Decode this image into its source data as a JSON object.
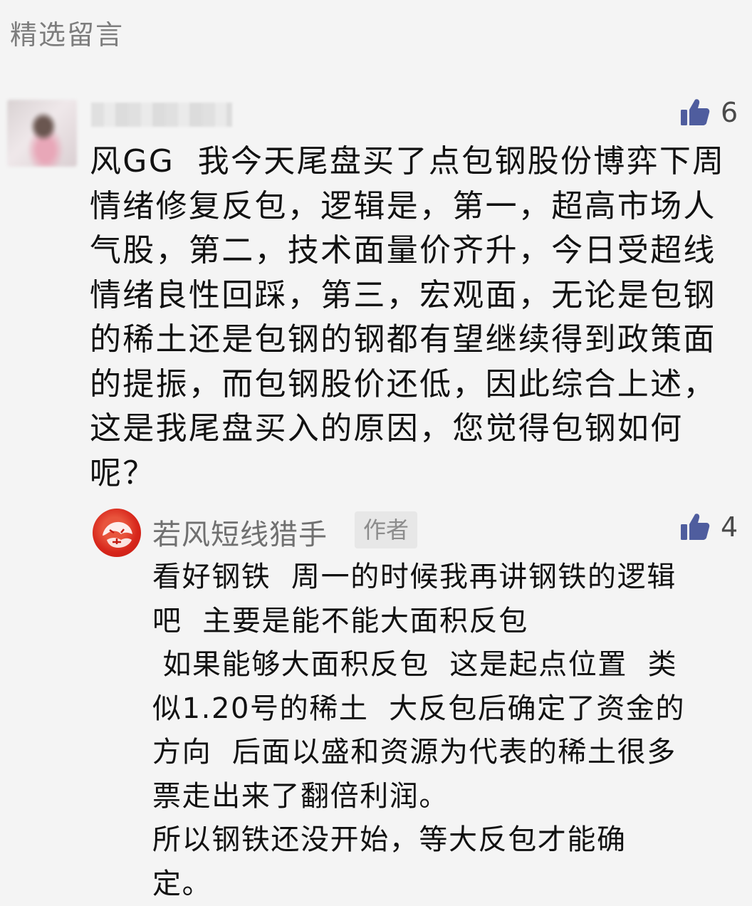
{
  "section": {
    "title": "精选留言"
  },
  "comment": {
    "likes": "6",
    "lines": [
      "风GG  我今天尾盘买了点包钢股份博弈下周",
      "情绪修复反包，逻辑是，第一，超高市场人",
      "气股，第二，技术面量价齐升，今日受超线",
      "情绪良性回踩，第三，宏观面，无论是包钢",
      "的稀土还是包钢的钢都有望继续得到政策面",
      "的提振，而包钢股价还低，因此综合上述，",
      "这是我尾盘买入的原因，您觉得包钢如何",
      "呢？"
    ]
  },
  "reply": {
    "author": "若风短线猎手",
    "badge": "作者",
    "likes": "4",
    "lines": [
      "看好钢铁  周一的时候我再讲钢铁的逻辑",
      "吧  主要是能不能大面积反包",
      " 如果能够大面积反包  这是起点位置  类",
      "似1.20号的稀土  大反包后确定了资金的",
      "方向  后面以盛和资源为代表的稀土很多",
      "票走出来了翻倍利润。",
      "所以钢铁还没开始，等大反包才能确",
      "定。"
    ]
  },
  "icons": {
    "like": "thumbs-up-icon"
  },
  "colors": {
    "background": "#f4f4f4",
    "like_icon": "#4f5d9e",
    "avatar_red": "#d7261b"
  }
}
